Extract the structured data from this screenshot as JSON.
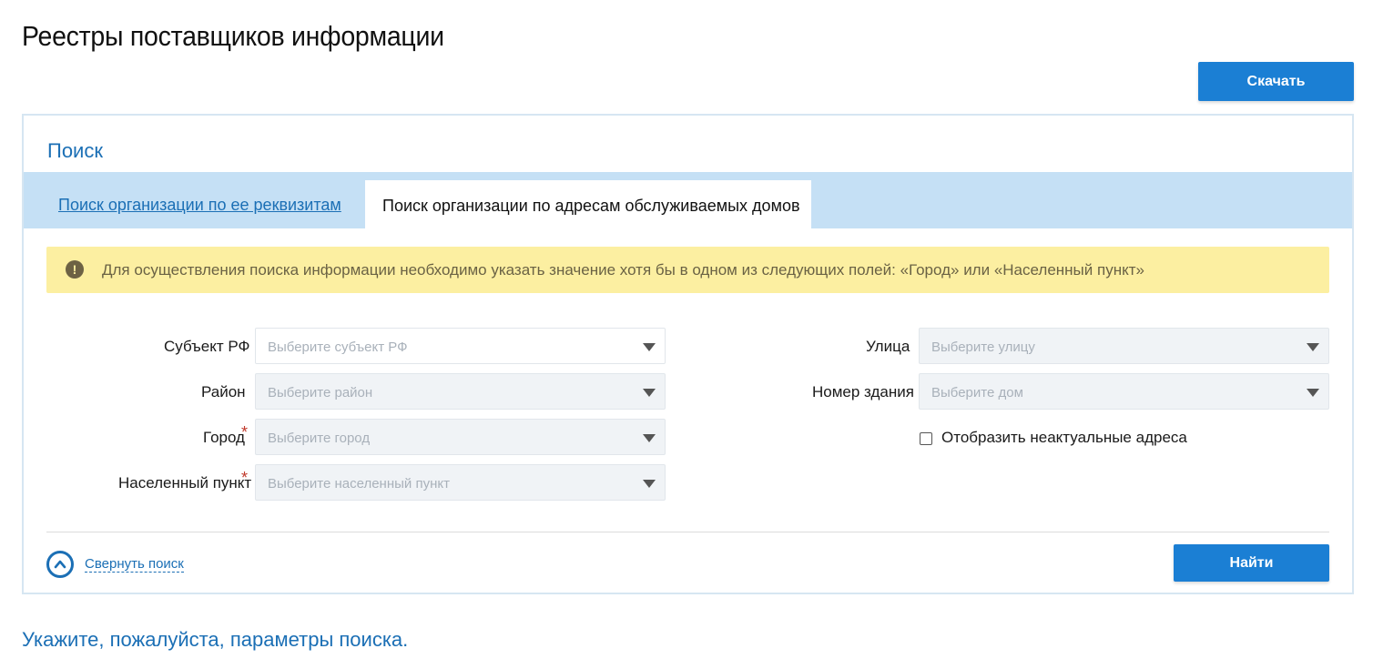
{
  "page": {
    "title": "Реестры поставщиков информации",
    "download_label": "Скачать"
  },
  "search": {
    "title": "Поиск",
    "tabs": [
      {
        "label": "Поиск организации по ее реквизитам",
        "active": false
      },
      {
        "label": "Поиск организации по адресам обслуживаемых домов",
        "active": true
      }
    ],
    "warning": {
      "icon": "exclamation-icon",
      "text": "Для осуществления поиска информации необходимо указать значение хотя бы в одном из следующих полей: «Город» или «Населенный пункт»"
    },
    "fields_left": [
      {
        "label": "Субъект РФ",
        "placeholder": "Выберите субъект РФ",
        "required": false
      },
      {
        "label": "Район",
        "placeholder": "Выберите район",
        "required": false
      },
      {
        "label": "Город",
        "placeholder": "Выберите город",
        "required": true
      },
      {
        "label": "Населенный пункт",
        "placeholder": "Выберите населенный пункт",
        "required": true
      }
    ],
    "fields_right": [
      {
        "label": "Улица",
        "placeholder": "Выберите улицу",
        "required": false
      },
      {
        "label": "Номер здания",
        "placeholder": "Выберите дом",
        "required": false
      }
    ],
    "required_mark": "*",
    "checkbox": {
      "label": "Отобразить неактуальные адреса",
      "checked": false
    },
    "collapse_label": "Свернуть поиск",
    "find_label": "Найти"
  },
  "hint": "Укажите, пожалуйста, параметры поиска.",
  "colors": {
    "accent": "#1b7fd4",
    "link": "#1b6fb5",
    "tabs_bg": "#c5e0f5",
    "warning_bg": "#fcefa1",
    "required": "#c0392b"
  }
}
